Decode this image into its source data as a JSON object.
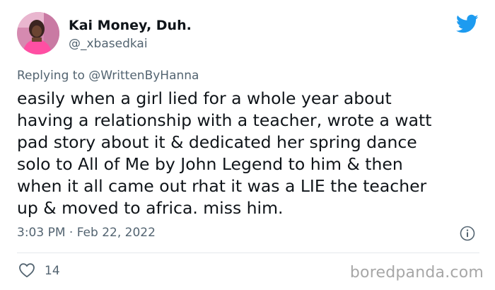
{
  "tweet": {
    "author": {
      "display_name": "Kai Money, Duh.",
      "handle": "@_xbasedkai"
    },
    "reply": {
      "prefix": "Replying to ",
      "mention": "@WrittenByHanna"
    },
    "text": "easily when a girl lied for a whole year about\nhaving a relationship with a teacher, wrote a watt\npad story about it & dedicated her spring dance\nsolo to All of Me by John Legend to him & then\nwhen it all came out rhat it was a LIE the teacher\nup & moved to africa. miss him.",
    "timestamp": "3:03 PM · Feb 22, 2022",
    "likes": "14"
  },
  "watermark": "boredpanda.com",
  "colors": {
    "twitter_blue": "#1d9bf0",
    "secondary_text": "#536471",
    "primary_text": "#0f1419"
  },
  "icons": [
    "twitter-bird-icon",
    "info-icon",
    "heart-icon"
  ]
}
